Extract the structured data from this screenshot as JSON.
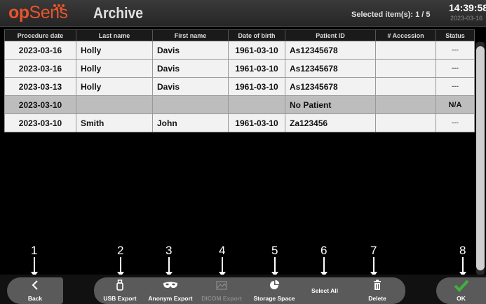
{
  "header": {
    "brand": "opSens",
    "title": "Archive",
    "selected_text": "Selected item(s):  1 / 5",
    "time": "14:39:58",
    "date": "2023-03-16"
  },
  "table": {
    "columns": [
      "Procedure date",
      "Last name",
      "First name",
      "Date of birth",
      "Patient ID",
      "# Accession",
      "Status"
    ],
    "rows": [
      {
        "procedure_date": "2023-03-16",
        "last_name": "Holly",
        "first_name": "Davis",
        "dob": "1961-03-10",
        "patient_id": "As12345678",
        "accession": "",
        "status": "---",
        "selected": false
      },
      {
        "procedure_date": "2023-03-16",
        "last_name": "Holly",
        "first_name": "Davis",
        "dob": "1961-03-10",
        "patient_id": "As12345678",
        "accession": "",
        "status": "---",
        "selected": false
      },
      {
        "procedure_date": "2023-03-13",
        "last_name": "Holly",
        "first_name": "Davis",
        "dob": "1961-03-10",
        "patient_id": "As12345678",
        "accession": "",
        "status": "---",
        "selected": false
      },
      {
        "procedure_date": "2023-03-10",
        "last_name": "",
        "first_name": "",
        "dob": "",
        "patient_id": "No Patient",
        "accession": "",
        "status": "N/A",
        "selected": true
      },
      {
        "procedure_date": "2023-03-10",
        "last_name": "Smith",
        "first_name": "John",
        "dob": "1961-03-10",
        "patient_id": "Za123456",
        "accession": "",
        "status": "---",
        "selected": false
      }
    ]
  },
  "callouts": [
    "1",
    "2",
    "3",
    "4",
    "5",
    "6",
    "7",
    "8"
  ],
  "toolbar": {
    "back": {
      "label": "Back",
      "icon": "chevron-left-icon"
    },
    "usb_export": {
      "label": "USB Export",
      "icon": "usb-icon"
    },
    "anonym_export": {
      "label": "Anonym Export",
      "icon": "mask-icon"
    },
    "dicom_export": {
      "label": "DICOM Export",
      "icon": "dicom-icon",
      "disabled": true
    },
    "storage_space": {
      "label": "Storage Space",
      "icon": "pie-chart-icon"
    },
    "select_all": {
      "label": "Select All"
    },
    "delete": {
      "label": "Delete",
      "icon": "trash-icon"
    },
    "ok": {
      "label": "OK",
      "icon": "checkmark-icon"
    }
  },
  "colors": {
    "brand_orange": "#e8542a",
    "ok_green": "#3cb43c",
    "selected_row": "#bdbdbd"
  }
}
